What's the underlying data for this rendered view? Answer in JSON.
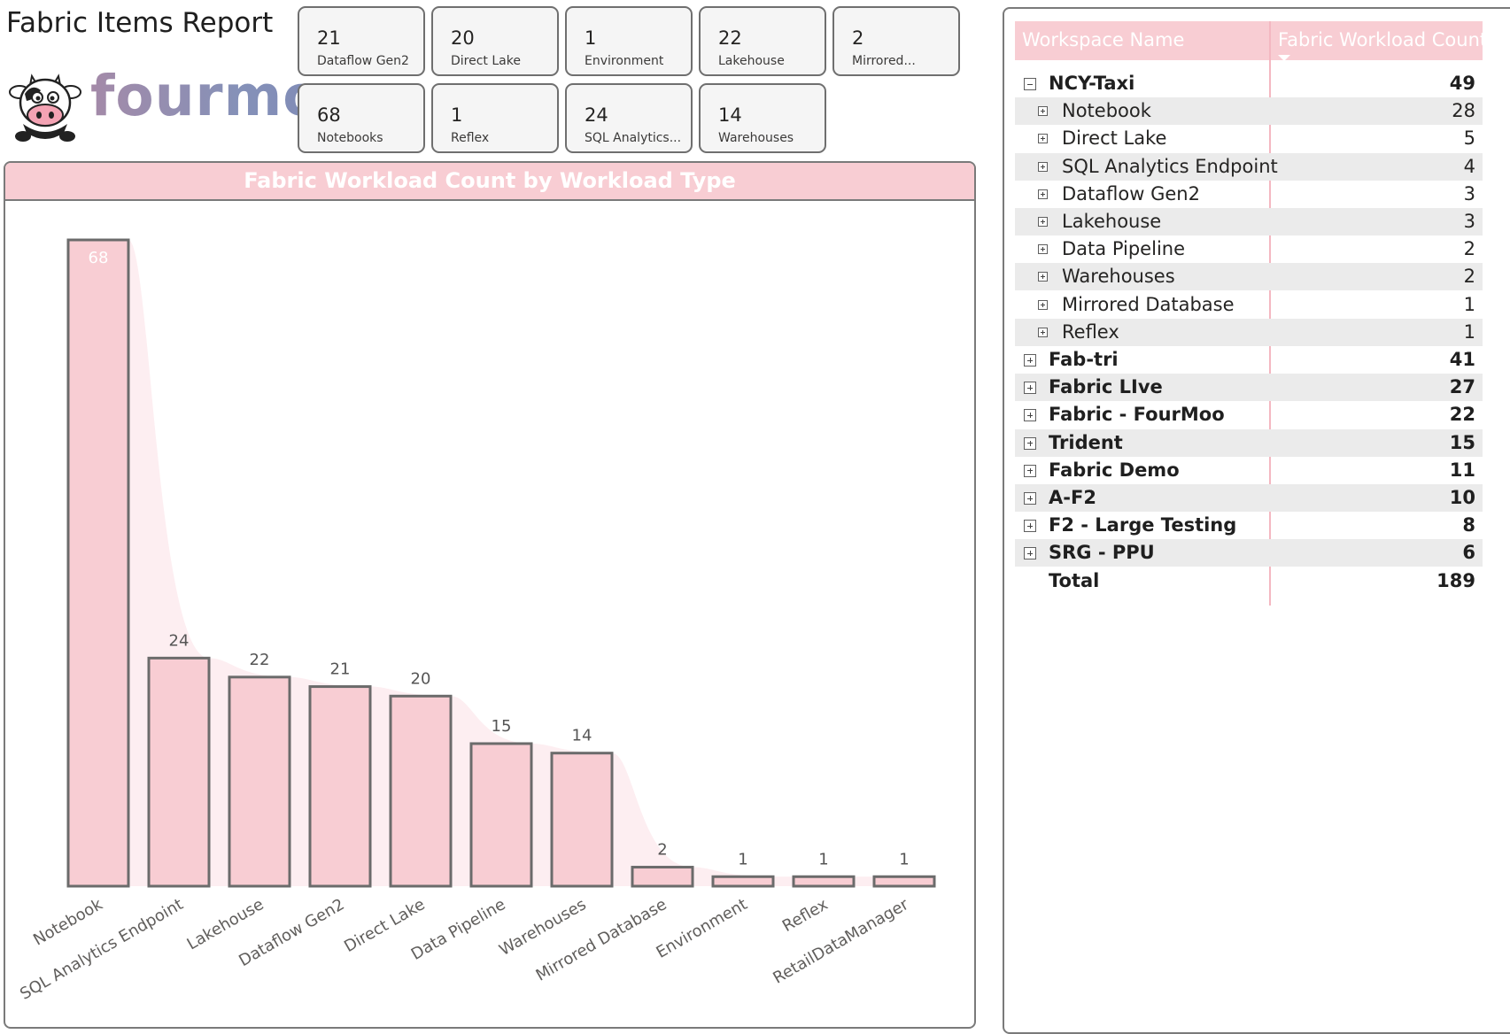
{
  "report": {
    "title": "Fabric Items Report"
  },
  "logo": {
    "text": "fourmoo"
  },
  "cards": [
    {
      "value": "21",
      "label": "Dataflow Gen2"
    },
    {
      "value": "20",
      "label": "Direct Lake"
    },
    {
      "value": "1",
      "label": "Environment"
    },
    {
      "value": "22",
      "label": "Lakehouse"
    },
    {
      "value": "2",
      "label": "Mirrored..."
    },
    {
      "value": "68",
      "label": "Notebooks"
    },
    {
      "value": "1",
      "label": "Reflex"
    },
    {
      "value": "24",
      "label": "SQL Analytics..."
    },
    {
      "value": "14",
      "label": "Warehouses"
    }
  ],
  "chart_data": {
    "type": "bar",
    "title": "Fabric Workload Count by Workload Type",
    "categories": [
      "Notebook",
      "SQL Analytics Endpoint",
      "Lakehouse",
      "Dataflow Gen2",
      "Direct Lake",
      "Data Pipeline",
      "Warehouses",
      "Mirrored Database",
      "Environment",
      "Reflex",
      "RetailDataManager"
    ],
    "values": [
      68,
      24,
      22,
      21,
      20,
      15,
      14,
      2,
      1,
      1,
      1
    ],
    "xlabel": "",
    "ylabel": "",
    "ylim": [
      0,
      68
    ],
    "grid": false,
    "bar_color": "#f8cdd3",
    "bar_stroke": "#6b6b6b"
  },
  "matrix": {
    "col_workspace": "Workspace Name",
    "col_count": "Fabric Workload Count",
    "rows": [
      {
        "name": "NCY-Taxi",
        "value": "49",
        "level": 0,
        "expanded": true
      },
      {
        "name": "Notebook",
        "value": "28",
        "level": 1
      },
      {
        "name": "Direct Lake",
        "value": "5",
        "level": 1
      },
      {
        "name": "SQL Analytics Endpoint",
        "value": "4",
        "level": 1
      },
      {
        "name": "Dataflow Gen2",
        "value": "3",
        "level": 1
      },
      {
        "name": "Lakehouse",
        "value": "3",
        "level": 1
      },
      {
        "name": "Data Pipeline",
        "value": "2",
        "level": 1
      },
      {
        "name": "Warehouses",
        "value": "2",
        "level": 1
      },
      {
        "name": "Mirrored Database",
        "value": "1",
        "level": 1
      },
      {
        "name": "Reflex",
        "value": "1",
        "level": 1
      },
      {
        "name": "Fab-tri",
        "value": "41",
        "level": 0,
        "expanded": false
      },
      {
        "name": "Fabric LIve",
        "value": "27",
        "level": 0,
        "expanded": false
      },
      {
        "name": "Fabric - FourMoo",
        "value": "22",
        "level": 0,
        "expanded": false
      },
      {
        "name": "Trident",
        "value": "15",
        "level": 0,
        "expanded": false
      },
      {
        "name": "Fabric Demo",
        "value": "11",
        "level": 0,
        "expanded": false
      },
      {
        "name": "A-F2",
        "value": "10",
        "level": 0,
        "expanded": false
      },
      {
        "name": "F2 - Large Testing",
        "value": "8",
        "level": 0,
        "expanded": false
      },
      {
        "name": "SRG - PPU",
        "value": "6",
        "level": 0,
        "expanded": false
      }
    ],
    "total_label": "Total",
    "total_value": "189"
  }
}
